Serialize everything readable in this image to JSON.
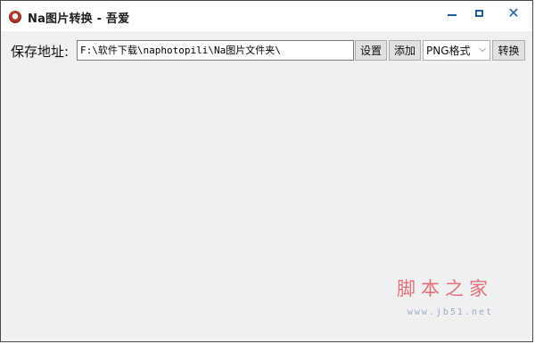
{
  "window": {
    "title": "Na图片转换 - 吾爱"
  },
  "toolbar": {
    "save_label": "保存地址:",
    "path_value": "F:\\软件下载\\naphotopili\\Na图片文件夹\\",
    "settings_label": "设置",
    "add_label": "添加",
    "format_selected": "PNG格式",
    "convert_label": "转换"
  },
  "watermark": {
    "brand": "脚本之家",
    "url": "www.jb51.net"
  }
}
